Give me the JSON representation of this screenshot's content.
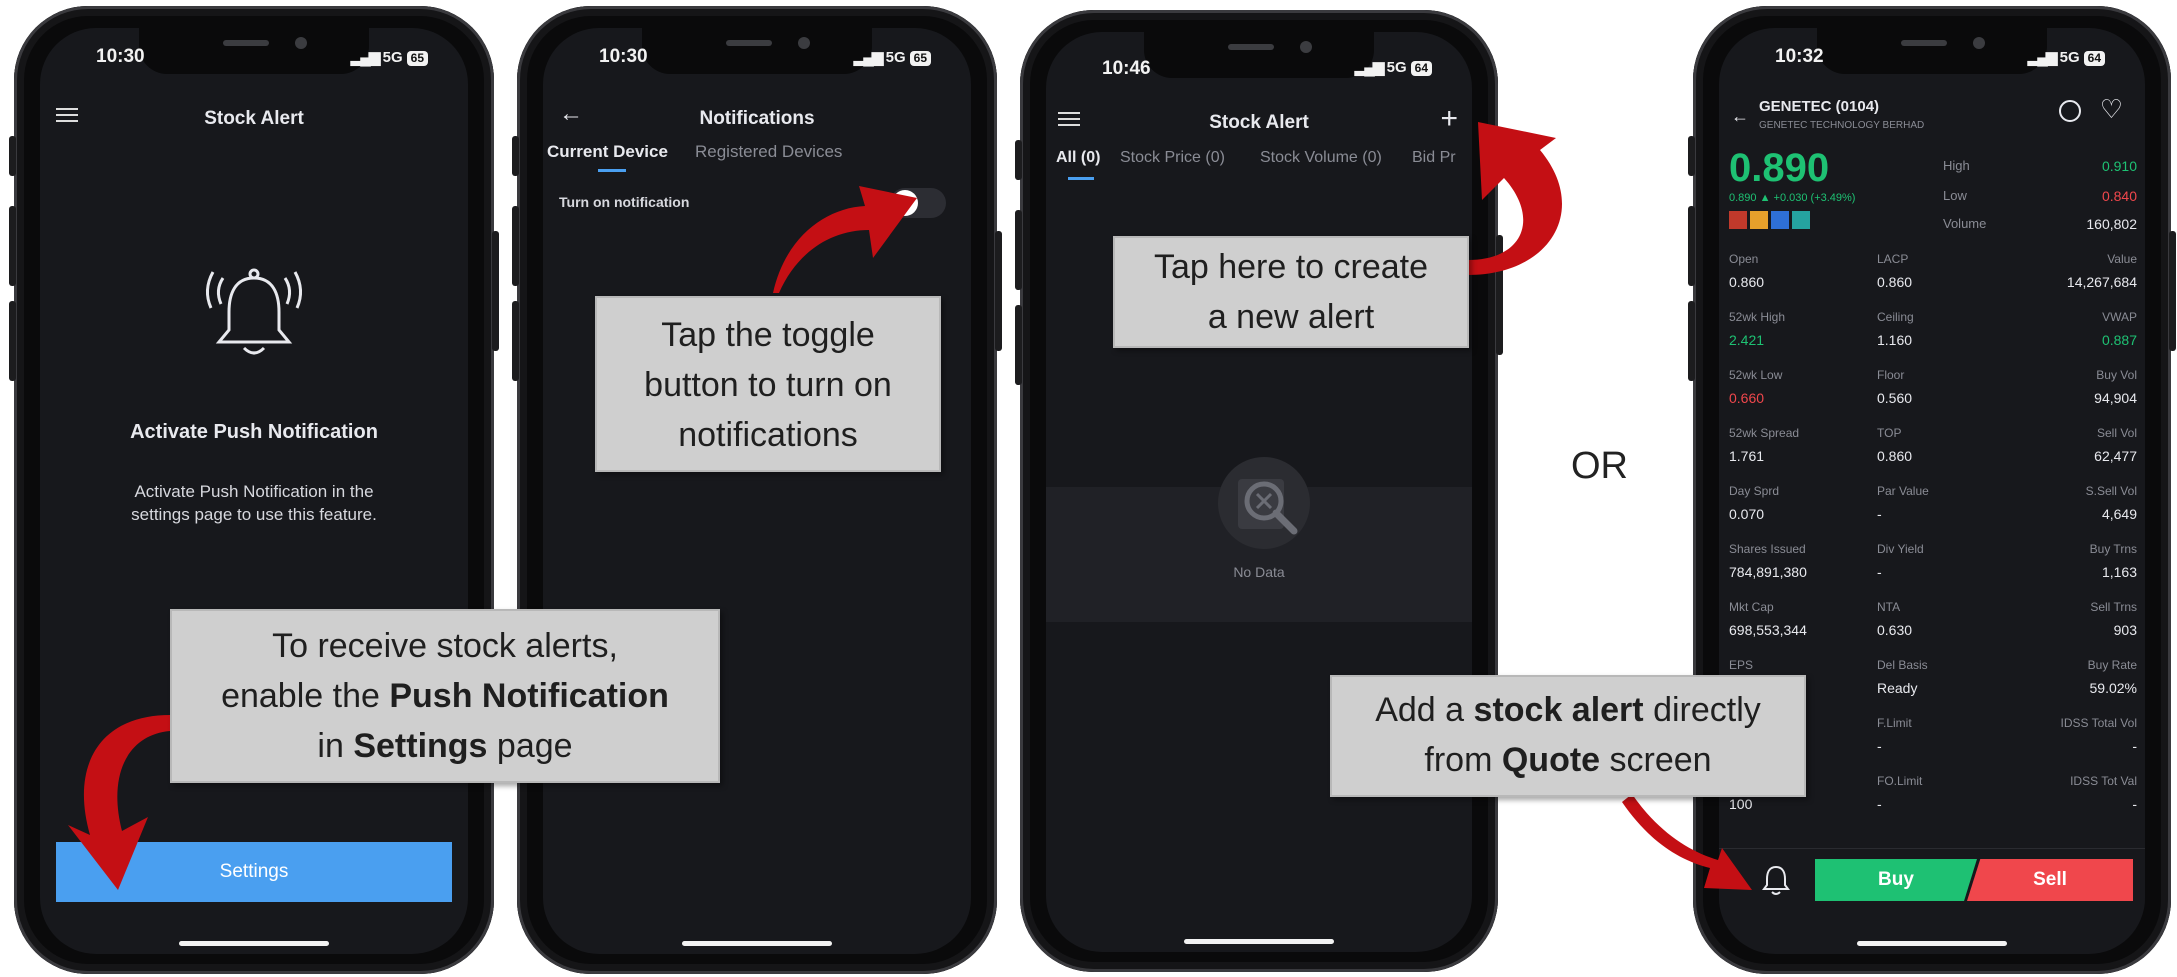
{
  "status": {
    "p1_time": "10:30",
    "p2_time": "10:30",
    "p3_time": "10:46",
    "p4_time": "10:32",
    "network": "5G",
    "batt1": "65",
    "batt2": "65",
    "batt3": "64",
    "batt4": "64"
  },
  "phone1": {
    "title": "Stock Alert",
    "heading": "Activate Push Notification",
    "body": "Activate Push Notification in the settings page to use this feature.",
    "settings_button": "Settings"
  },
  "phone2": {
    "title": "Notifications",
    "tab_current": "Current Device",
    "tab_registered": "Registered Devices",
    "toggle_label": "Turn on notification"
  },
  "phone3": {
    "title": "Stock Alert",
    "add_icon": "plus-icon",
    "tabs": [
      "All (0)",
      "Stock Price (0)",
      "Stock Volume (0)",
      "Bid Pr"
    ],
    "empty": "No Data"
  },
  "phone4": {
    "code": "GENETEC (0104)",
    "company": "GENETEC TECHNOLOGY BERHAD",
    "price": "0.890",
    "change": "0.890 ▲ +0.030 (+3.49%)",
    "high_label": "High",
    "high": "0.910",
    "low_label": "Low",
    "low": "0.840",
    "volume_label": "Volume",
    "volume": "160,802",
    "rows": [
      {
        "l1": "Open",
        "v1": "0.860",
        "l2": "LACP",
        "v2": "0.860",
        "l3": "Value",
        "v3": "14,267,684"
      },
      {
        "l1": "52wk High",
        "v1": "2.421",
        "l2": "Ceiling",
        "v2": "1.160",
        "l3": "VWAP",
        "v3": "0.887"
      },
      {
        "l1": "52wk Low",
        "v1": "0.660",
        "l2": "Floor",
        "v2": "0.560",
        "l3": "Buy Vol",
        "v3": "94,904"
      },
      {
        "l1": "52wk Spread",
        "v1": "1.761",
        "l2": "TOP",
        "v2": "0.860",
        "l3": "Sell Vol",
        "v3": "62,477"
      },
      {
        "l1": "Day Sprd",
        "v1": "0.070",
        "l2": "Par Value",
        "v2": "-",
        "l3": "S.Sell Vol",
        "v3": "4,649"
      },
      {
        "l1": "Shares Issued",
        "v1": "784,891,380",
        "l2": "Div Yield",
        "v2": "-",
        "l3": "Buy Trns",
        "v3": "1,163"
      },
      {
        "l1": "Mkt Cap",
        "v1": "698,553,344",
        "l2": "NTA",
        "v2": "0.630",
        "l3": "Sell Trns",
        "v3": "903"
      },
      {
        "l1": "EPS",
        "v1": "",
        "l2": "Del Basis",
        "v2": "Ready",
        "l3": "Buy Rate",
        "v3": "59.02%"
      },
      {
        "l1": "",
        "v1": "",
        "l2": "F.Limit",
        "v2": "-",
        "l3": "IDSS Total Vol",
        "v3": "-"
      },
      {
        "l1": "",
        "v1": "100",
        "l2": "FO.Limit",
        "v2": "-",
        "l3": "IDSS Tot Val",
        "v3": "-"
      }
    ],
    "buy": "Buy",
    "sell": "Sell"
  },
  "callouts": {
    "c1_line1": "To receive stock alerts,",
    "c1_line2_pre": "enable the ",
    "c1_line2_bold": "Push Notification",
    "c1_line3_pre": "in ",
    "c1_line3_bold": "Settings",
    "c1_line3_post": " page",
    "c2_line1": "Tap the toggle",
    "c2_line2": "button to turn on",
    "c2_line3": "notifications",
    "c3_line1": "Tap here to create",
    "c3_line2": "a new alert",
    "c4_line1_pre": "Add a ",
    "c4_line1_bold": "stock alert",
    "c4_line1_post": " directly",
    "c4_line2_pre": "from ",
    "c4_line2_bold": "Quote",
    "c4_line2_post": " screen"
  },
  "or_text": "OR",
  "colors": {
    "accent": "#4a9ff0",
    "arrow": "#c40f14",
    "buy": "#1ec173",
    "sell": "#f0474c"
  }
}
